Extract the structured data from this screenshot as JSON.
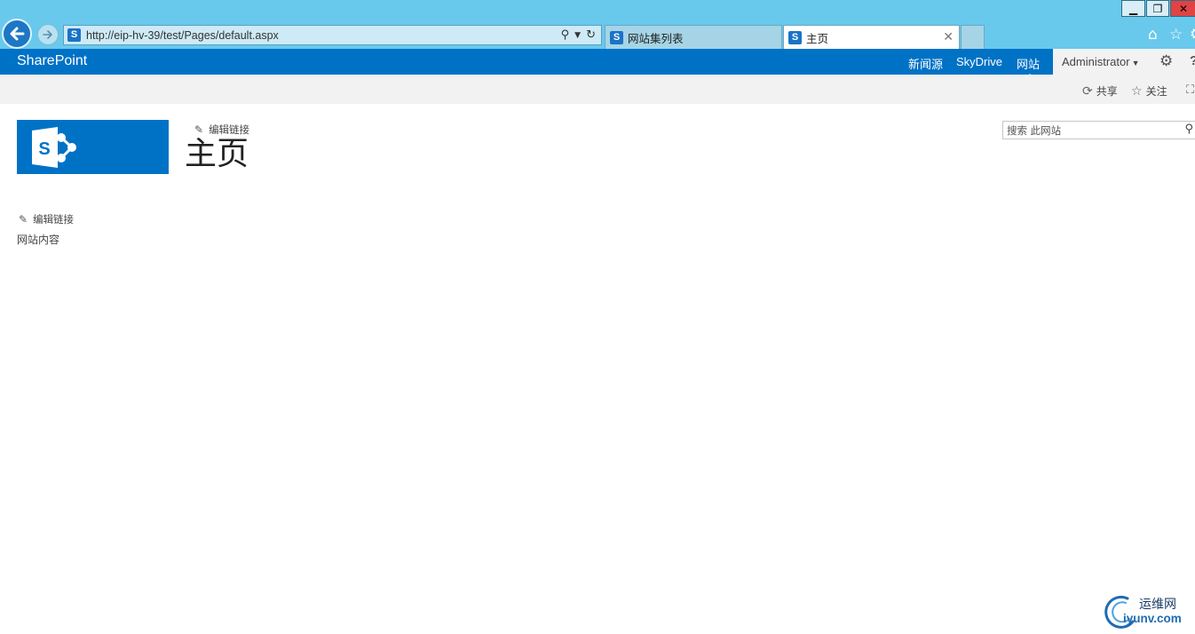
{
  "browser": {
    "url": "http://eip-hv-39/test/Pages/default.aspx",
    "tabs": [
      {
        "label": "网站集列表",
        "active": false
      },
      {
        "label": "主页",
        "active": true
      }
    ],
    "window_buttons": {
      "minimize": "▁",
      "restore": "❐",
      "close": "✕"
    },
    "icons": [
      "back-arrow-icon",
      "forward-arrow-icon",
      "search-icon",
      "refresh-icon",
      "home-icon",
      "star-icon",
      "gear-icon"
    ]
  },
  "suitebar": {
    "brand": "SharePoint",
    "links": [
      "新闻源",
      "SkyDrive",
      "网站"
    ],
    "user": "Administrator",
    "color": "#0072c6"
  },
  "ribbon": {
    "share": "共享",
    "follow": "关注"
  },
  "page": {
    "edit_links": "编辑链接",
    "title": "主页",
    "search_placeholder": "搜索 此网站",
    "quicklaunch": {
      "edit_links": "编辑链接",
      "items": [
        "网站内容"
      ]
    }
  },
  "watermark": {
    "cn": "运维网",
    "en": "iyunv.com"
  }
}
